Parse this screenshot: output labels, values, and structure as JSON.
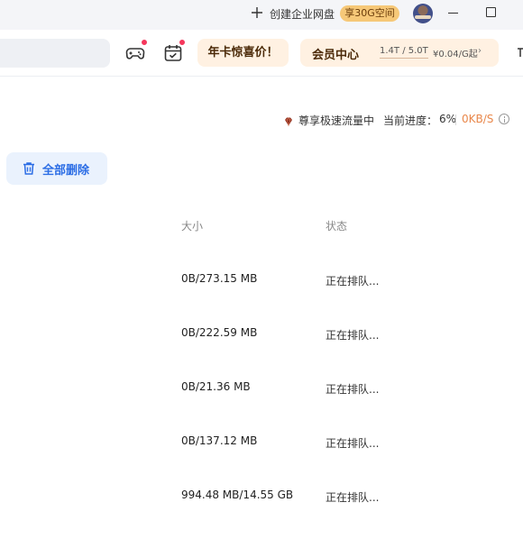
{
  "titlebar": {
    "create_label": "创建企业网盘",
    "badge": "享30G空间",
    "icons": [
      "plus-icon",
      "minimize-icon",
      "maximize-icon"
    ]
  },
  "toolbar": {
    "promo_label": "年卡惊喜价！",
    "vip": {
      "title": "会员中心",
      "storage": "1.4T / 5.0T",
      "price": "¥0.04/G起",
      "arrow": "›"
    },
    "icons": [
      "gamepad-icon",
      "calendar-check-icon"
    ]
  },
  "speed": {
    "label": "尊享极速流量中",
    "progress_label": "当前进度：",
    "progress_value": "6%",
    "speed_value": "0KB/S",
    "speed_color": "#e9874a"
  },
  "actions": {
    "delete_all": "全部删除",
    "accent": "#2b6de5"
  },
  "table": {
    "columns": {
      "size": "大小",
      "status": "状态"
    },
    "rows": [
      {
        "size": "0B/273.15 MB",
        "status": "正在排队..."
      },
      {
        "size": "0B/222.59 MB",
        "status": "正在排队..."
      },
      {
        "size": "0B/21.36 MB",
        "status": "正在排队..."
      },
      {
        "size": "0B/137.12 MB",
        "status": "正在排队..."
      },
      {
        "size": "994.48 MB/14.55 GB",
        "status": "正在排队..."
      }
    ]
  }
}
